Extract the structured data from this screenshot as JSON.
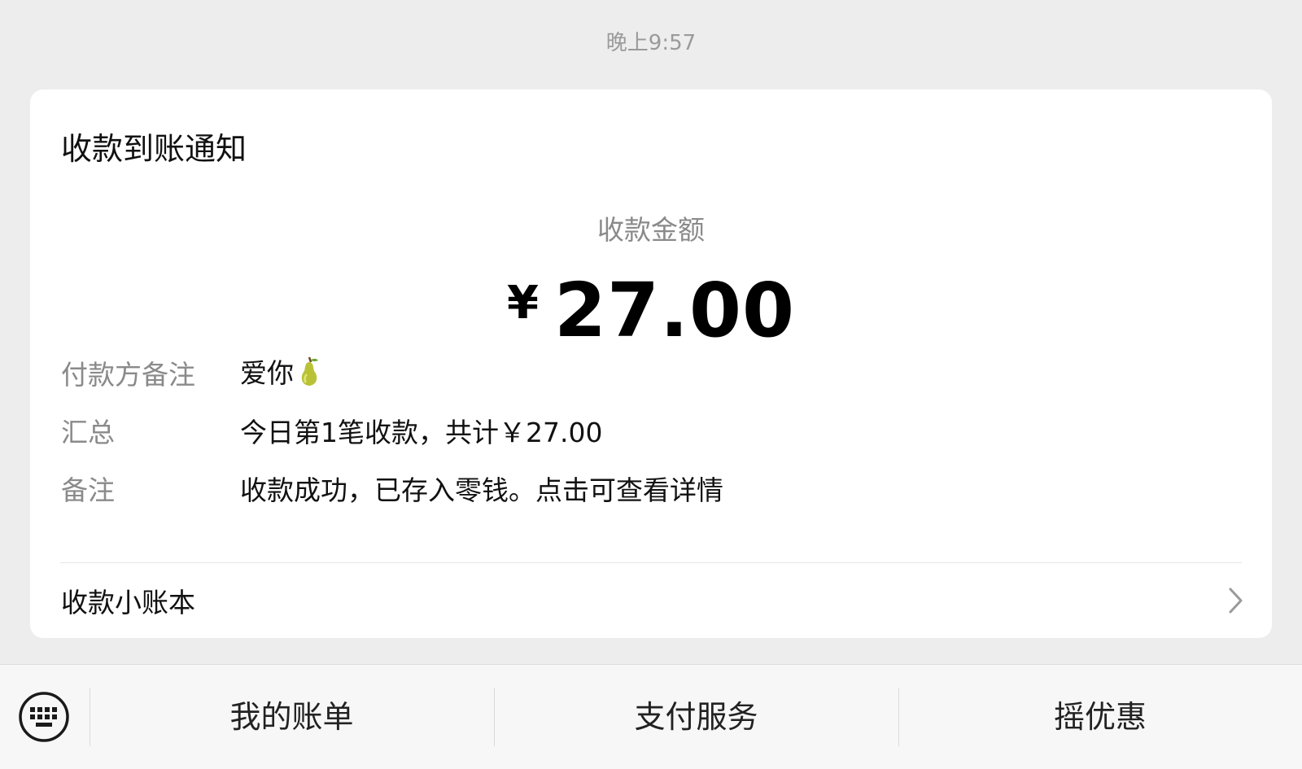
{
  "timestamp": "晚上9:57",
  "card": {
    "title": "收款到账通知",
    "amount_label": "收款金额",
    "currency_symbol": "¥",
    "amount": "27.00",
    "rows": [
      {
        "label": "付款方备注",
        "value": "爱你",
        "icon": "pear-icon"
      },
      {
        "label": "汇总",
        "value": "今日第1笔收款，共计￥27.00"
      },
      {
        "label": "备注",
        "value": "收款成功，已存入零钱。点击可查看详情"
      }
    ],
    "ledger_label": "收款小账本"
  },
  "bottom_menu": {
    "keyboard_icon": "keyboard-icon",
    "items": [
      {
        "label": "我的账单"
      },
      {
        "label": "支付服务"
      },
      {
        "label": "摇优惠"
      }
    ]
  },
  "colors": {
    "background": "#ededed",
    "card": "#ffffff",
    "label_gray": "#8a8a8a",
    "text_dark": "#111111"
  }
}
